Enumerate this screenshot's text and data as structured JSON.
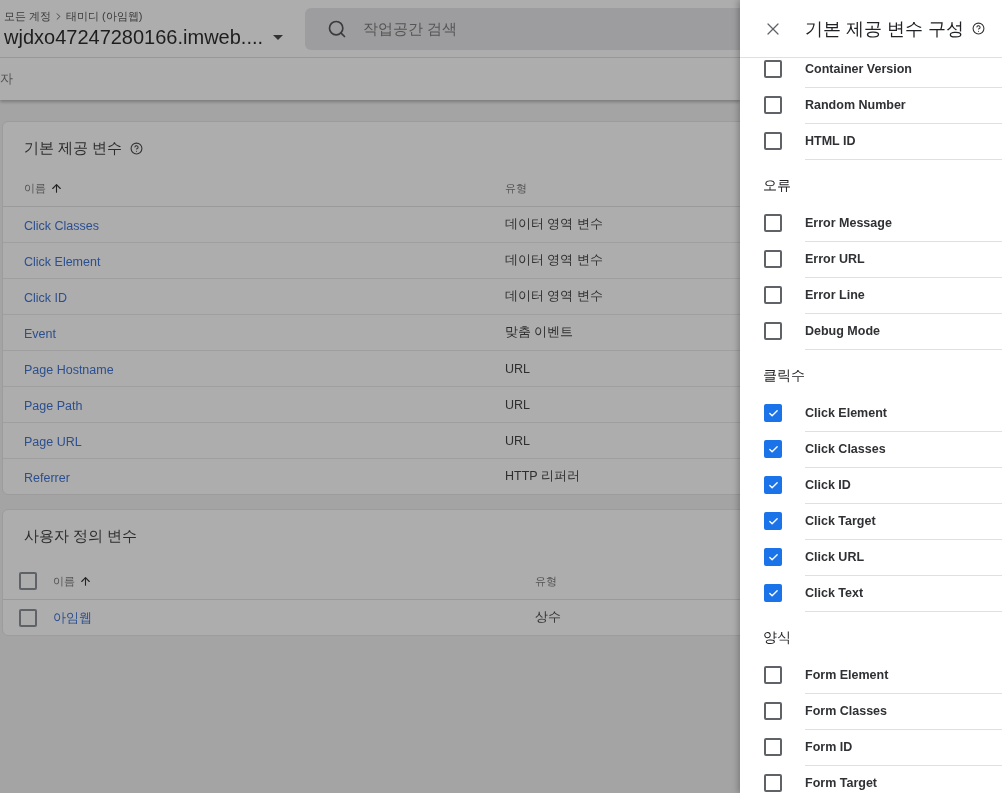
{
  "header": {
    "breadcrumb": [
      "모든 계정",
      "태미디 (아임웹)"
    ],
    "container_name": "wjdxo47247280166.imweb....",
    "search": {
      "placeholder": "작업공간 검색"
    },
    "subnav_text": "자"
  },
  "builtin_card": {
    "title": "기본 제공 변수",
    "columns": [
      "이름",
      "유형"
    ],
    "rows": [
      {
        "name": "Click Classes",
        "type": "데이터 영역 변수"
      },
      {
        "name": "Click Element",
        "type": "데이터 영역 변수"
      },
      {
        "name": "Click ID",
        "type": "데이터 영역 변수"
      },
      {
        "name": "Event",
        "type": "맞춤 이벤트"
      },
      {
        "name": "Page Hostname",
        "type": "URL"
      },
      {
        "name": "Page Path",
        "type": "URL"
      },
      {
        "name": "Page URL",
        "type": "URL"
      },
      {
        "name": "Referrer",
        "type": "HTTP 리퍼러"
      }
    ]
  },
  "custom_card": {
    "title": "사용자 정의 변수",
    "select_all": {
      "checked": false
    },
    "columns": [
      "이름",
      "유형"
    ],
    "rows": [
      {
        "name": "아임웹",
        "type": "상수",
        "checked": false
      }
    ]
  },
  "panel": {
    "title": "기본 제공 변수 구성",
    "sections": [
      {
        "items": [
          {
            "label": "Container Version",
            "checked": false
          },
          {
            "label": "Random Number",
            "checked": false
          },
          {
            "label": "HTML ID",
            "checked": false
          }
        ]
      },
      {
        "heading": "오류",
        "items": [
          {
            "label": "Error Message",
            "checked": false
          },
          {
            "label": "Error URL",
            "checked": false
          },
          {
            "label": "Error Line",
            "checked": false
          },
          {
            "label": "Debug Mode",
            "checked": false
          }
        ]
      },
      {
        "heading": "클릭수",
        "items": [
          {
            "label": "Click Element",
            "checked": true
          },
          {
            "label": "Click Classes",
            "checked": true
          },
          {
            "label": "Click ID",
            "checked": true
          },
          {
            "label": "Click Target",
            "checked": true
          },
          {
            "label": "Click URL",
            "checked": true
          },
          {
            "label": "Click Text",
            "checked": true
          }
        ]
      },
      {
        "heading": "양식",
        "items": [
          {
            "label": "Form Element",
            "checked": false
          },
          {
            "label": "Form Classes",
            "checked": false
          },
          {
            "label": "Form ID",
            "checked": false
          },
          {
            "label": "Form Target",
            "checked": false
          }
        ]
      }
    ]
  }
}
